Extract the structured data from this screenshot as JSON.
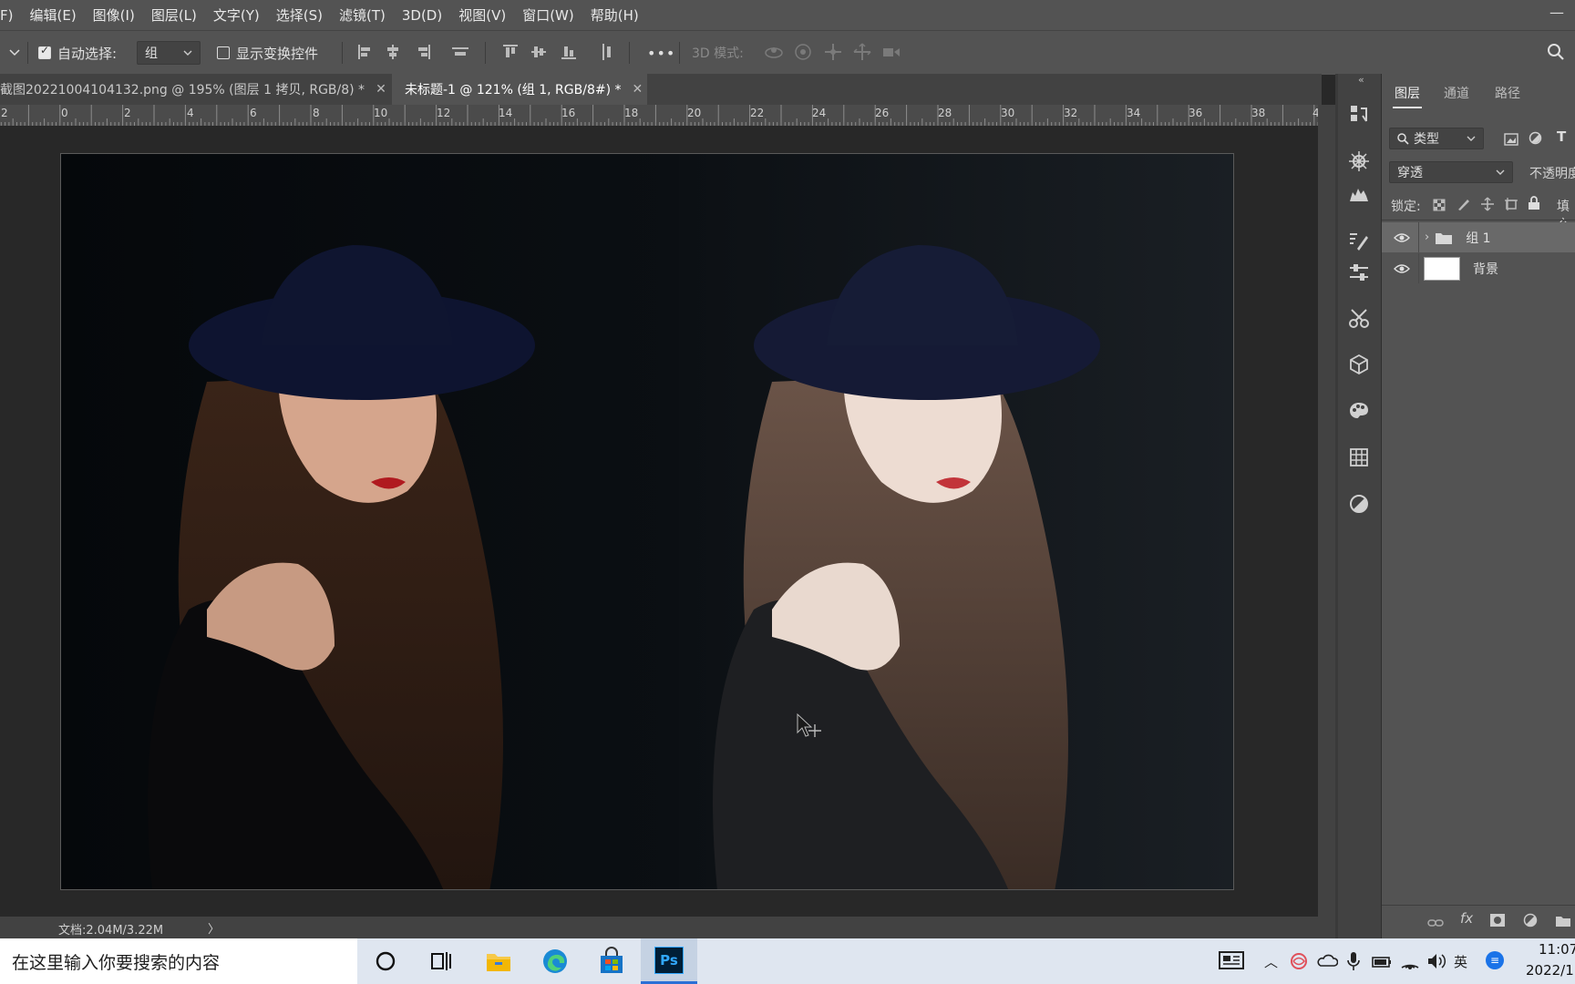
{
  "menu": {
    "partial_item": "F)",
    "items": [
      "编辑(E)",
      "图像(I)",
      "图层(L)",
      "文字(Y)",
      "选择(S)",
      "滤镜(T)",
      "3D(D)",
      "视图(V)",
      "窗口(W)",
      "帮助(H)"
    ]
  },
  "options_bar": {
    "auto_select_label": "自动选择:",
    "auto_select_checked": true,
    "auto_select_value": "组",
    "show_transform_label": "显示变换控件",
    "show_transform_checked": false,
    "more_label": "•••",
    "mode_3d_label": "3D 模式:"
  },
  "tabs": [
    {
      "label": "截图20221004104132.png @ 195% (图层 1 拷贝, RGB/8) *",
      "active": false
    },
    {
      "label": "未标题-1 @ 121% (组 1, RGB/8#) *",
      "active": true
    }
  ],
  "ruler": {
    "labels": [
      "2",
      "0",
      "2",
      "4",
      "6",
      "8",
      "10",
      "12",
      "14",
      "16",
      "18",
      "20",
      "22",
      "24",
      "26",
      "28",
      "30",
      "32",
      "34",
      "36",
      "38",
      "4"
    ]
  },
  "status": {
    "doc_size": "文档:2.04M/3.22M",
    "arrow": "〉"
  },
  "panel": {
    "tabs": [
      "图层",
      "通道",
      "路径"
    ],
    "filter_kind": "类型",
    "blend_mode": "穿透",
    "opacity_label": "不透明度",
    "lock_label": "锁定:",
    "fill_label": "填充",
    "layers": [
      {
        "name": "组 1",
        "type": "group",
        "visible": true,
        "selected": true
      },
      {
        "name": "背景",
        "type": "background",
        "visible": true,
        "selected": false
      }
    ],
    "fx_label": "fx"
  },
  "taskbar": {
    "search_placeholder": "在这里输入你要搜索的内容",
    "time": "11:07",
    "date": "2022/1",
    "ime": "英"
  },
  "colors": {
    "menu_bg": "#535353",
    "panel_bg": "#535353",
    "canvas_bg": "#282828",
    "ps_icon": "#31a8ff"
  }
}
